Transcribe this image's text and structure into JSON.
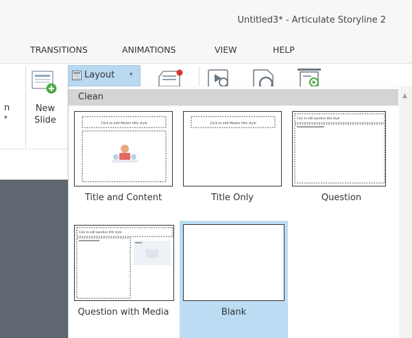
{
  "window": {
    "title": "Untitled3* -  Articulate Storyline 2"
  },
  "ribbon_tabs": [
    "TRANSITIONS",
    "ANIMATIONS",
    "VIEW",
    "HELP"
  ],
  "ribbon": {
    "partial_label_top": "n",
    "partial_caret": "▾",
    "new_slide_label": "New Slide",
    "layout_label": "Layout",
    "layout_caret": "▾"
  },
  "layout_gallery": {
    "category": "Clean",
    "scroll_up_glyph": "▲",
    "thumb_title_text": "Click to edit Master title style",
    "thumb_question_text": "Click to edit question title style",
    "layouts": [
      {
        "label": "Title and Content"
      },
      {
        "label": "Title Only"
      },
      {
        "label": "Question"
      },
      {
        "label": "Question with Media"
      },
      {
        "label": "Blank",
        "selected": true
      }
    ]
  },
  "colors": {
    "accent_selected": "#bcdcf3",
    "layout_button": "#b9d9f0",
    "category_header": "#d4d4d4",
    "left_panel": "#5f6770"
  }
}
